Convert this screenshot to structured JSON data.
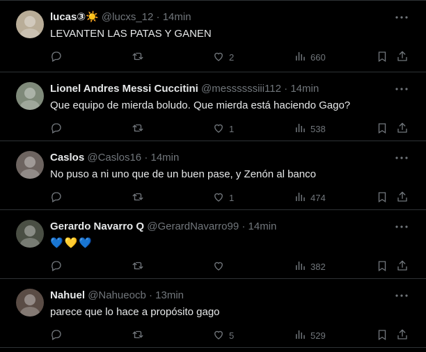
{
  "tweets": [
    {
      "name": "lucas",
      "name_suffix": "③",
      "name_emoji": "☀️",
      "handle": "@lucxs_12",
      "dot": "·",
      "time": "14min",
      "text": "LEVANTEN LAS PATAS Y GANEN",
      "likes": "2",
      "views": "660",
      "replies": "",
      "retweets": "",
      "avatar_color": "#b9ad98"
    },
    {
      "name": "Lionel Andres Messi Cuccitini",
      "name_suffix": "",
      "name_emoji": "",
      "handle": "@messssssiii112",
      "dot": "·",
      "time": "14min",
      "text": "Que equipo de mierda boludo. Que mierda está haciendo Gago?",
      "likes": "1",
      "views": "538",
      "replies": "",
      "retweets": "",
      "avatar_color": "#7f8a7a"
    },
    {
      "name": "Caslos",
      "name_suffix": "",
      "name_emoji": "",
      "handle": "@Caslos16",
      "dot": "·",
      "time": "14min",
      "text": "No puso a ni uno que de un buen pase, y Zenón al banco",
      "likes": "1",
      "views": "474",
      "replies": "",
      "retweets": "",
      "avatar_color": "#6d6460"
    },
    {
      "name": "Gerardo Navarro Q",
      "name_suffix": "",
      "name_emoji": "",
      "handle": "@GerardNavarro99",
      "dot": "·",
      "time": "14min",
      "text": "",
      "hearts": [
        "💙",
        "💛",
        "💙"
      ],
      "likes": "",
      "views": "382",
      "replies": "",
      "retweets": "",
      "avatar_color": "#4a4f44"
    },
    {
      "name": "Nahuel",
      "name_suffix": "",
      "name_emoji": "",
      "handle": "@Nahueocb",
      "dot": "·",
      "time": "13min",
      "text": "parece que lo hace a propósito gago",
      "likes": "5",
      "views": "529",
      "replies": "",
      "retweets": "",
      "avatar_color": "#5a4c45"
    }
  ],
  "icons": {
    "reply": "reply-icon",
    "retweet": "retweet-icon",
    "like": "heart-icon",
    "views": "views-icon",
    "bookmark": "bookmark-icon",
    "share": "share-icon",
    "more": "more-icon"
  },
  "colors": {
    "background": "#000000",
    "text": "#e7e9ea",
    "muted": "#71767b",
    "border": "#2f3336"
  }
}
